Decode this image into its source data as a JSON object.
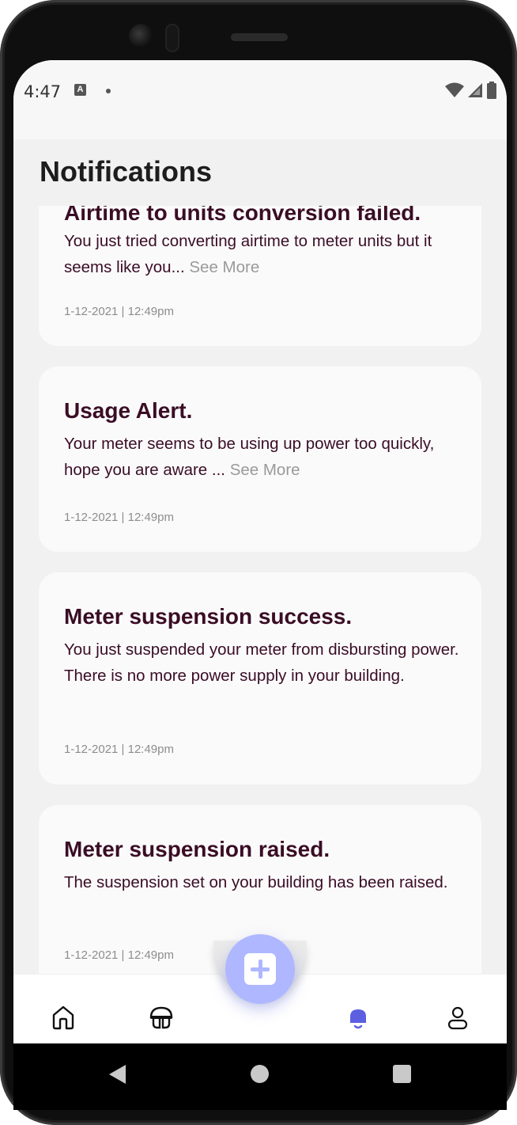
{
  "status_bar": {
    "time": "4:47",
    "keyboard_indicator": "A"
  },
  "page": {
    "title": "Notifications"
  },
  "notifications": [
    {
      "title": "Airtime to units conversion failed.",
      "body": "You just tried converting airtime to meter units but it seems like you... ",
      "see_more": "See More",
      "timestamp": "1-12-2021 | 12:49pm"
    },
    {
      "title": "Usage Alert.",
      "body": "Your meter seems to be using up power too quickly, hope you are aware ... ",
      "see_more": "See More",
      "timestamp": "1-12-2021 | 12:49pm"
    },
    {
      "title": "Meter suspension success.",
      "body": "You just suspended your meter from disbursting power. There is no more power supply in your building.",
      "timestamp": "1-12-2021 | 12:49pm"
    },
    {
      "title": "Meter suspension raised.",
      "body": "The suspension set on your building has been raised.",
      "timestamp": "1-12-2021 | 12:49pm"
    }
  ],
  "bottom_nav": {
    "items": [
      "home-icon",
      "meter-icon",
      "add-icon",
      "bell-icon",
      "profile-icon"
    ],
    "active": "bell-icon",
    "active_color": "#5b5fe0",
    "fab_color": "#aeb7ff"
  },
  "colors": {
    "card_title": "#3a0d25",
    "see_more": "#9a9a9a",
    "background": "#f1f1f1"
  }
}
